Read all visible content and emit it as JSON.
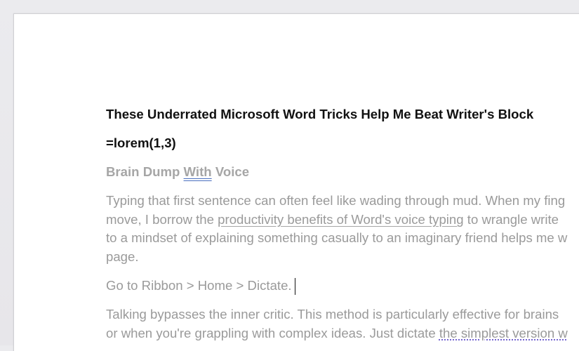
{
  "document": {
    "title": "These Underrated Microsoft Word Tricks Help Me Beat Writer's Block",
    "formula": "=lorem(1,3)",
    "section_heading": {
      "before": "Brain Dump ",
      "underlined": "With",
      "after": " Voice"
    },
    "paragraph1": {
      "line1": "Typing that first sentence can often feel like wading through mud. When my fing",
      "line2_before": "move, I borrow the ",
      "line2_link": "productivity benefits of Word's voice typing",
      "line2_after": " to wrangle write",
      "line3": "to a mindset of explaining something casually to an imaginary friend helps me w",
      "line4": "page."
    },
    "instruction": "Go to Ribbon > Home > Dictate.",
    "paragraph2": {
      "line1": "Talking bypasses the inner critic. This method is particularly effective for brains",
      "line2_before": "or when you're grappling with complex ideas. Just dictate ",
      "line2_link": "the simplest version w"
    }
  }
}
